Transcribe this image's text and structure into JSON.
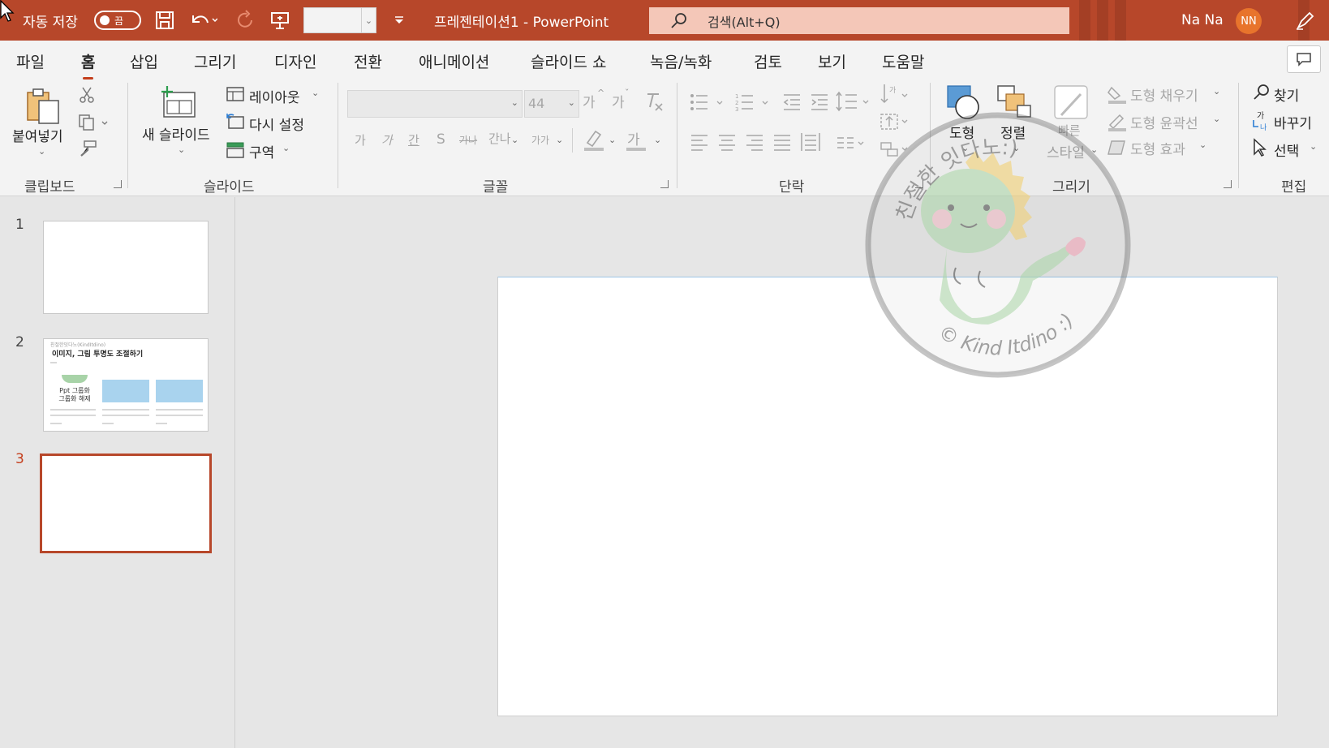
{
  "titlebar": {
    "autosave_label": "자동 저장",
    "autosave_state": "끔",
    "document_title": "프레젠테이션1  -  PowerPoint",
    "search_placeholder": "검색(Alt+Q)",
    "user_name": "Na Na",
    "user_initials": "NN",
    "colors": {
      "bar": "#b7472a",
      "search": "#f4c7b8",
      "avatar": "#e8742c"
    }
  },
  "tabs": [
    "파일",
    "홈",
    "삽입",
    "그리기",
    "디자인",
    "전환",
    "애니메이션",
    "슬라이드 쇼",
    "녹음/녹화",
    "검토",
    "보기",
    "도움말"
  ],
  "active_tab": "홈",
  "ribbon": {
    "clipboard": {
      "group_label": "클립보드",
      "paste_label": "붙여넣기"
    },
    "slides": {
      "group_label": "슬라이드",
      "new_slide_label": "새 슬라이드",
      "layout_label": "레이아웃",
      "reset_label": "다시 설정",
      "section_label": "구역"
    },
    "font": {
      "group_label": "글꼴",
      "font_name": "",
      "font_size": "44",
      "grow_label": "가",
      "shrink_label": "가",
      "bold_label": "가",
      "italic_label": "가",
      "underline_label": "간",
      "shadow_label": "S",
      "strike_label": "가나",
      "spacing_label": "간나",
      "case_label": "가가",
      "font_color_label": "가"
    },
    "paragraph": {
      "group_label": "단락"
    },
    "drawing": {
      "group_label": "그리기",
      "shapes_label": "도형",
      "arrange_label": "정렬",
      "quick_styles_line1": "빠른",
      "quick_styles_line2": "스타일",
      "shape_fill_label": "도형 채우기",
      "shape_outline_label": "도형 윤곽선",
      "shape_effects_label": "도형 효과"
    },
    "editing": {
      "group_label": "편집",
      "find_label": "찾기",
      "replace_label": "바꾸기",
      "select_label": "선택"
    }
  },
  "slides_panel": {
    "slides": [
      {
        "number": "1"
      },
      {
        "number": "2",
        "header": "친절한잇다노(KindItdino)",
        "title": "이미지, 그림 투명도 조절하기",
        "thumb_label_1": "Ppt 그룹화",
        "thumb_label_2": "그룹화 해제"
      },
      {
        "number": "3"
      }
    ],
    "selected": "3"
  },
  "watermark": {
    "text_top": "친절한 잇다노:)",
    "text_bottom": "© Kind Itdino :)"
  }
}
